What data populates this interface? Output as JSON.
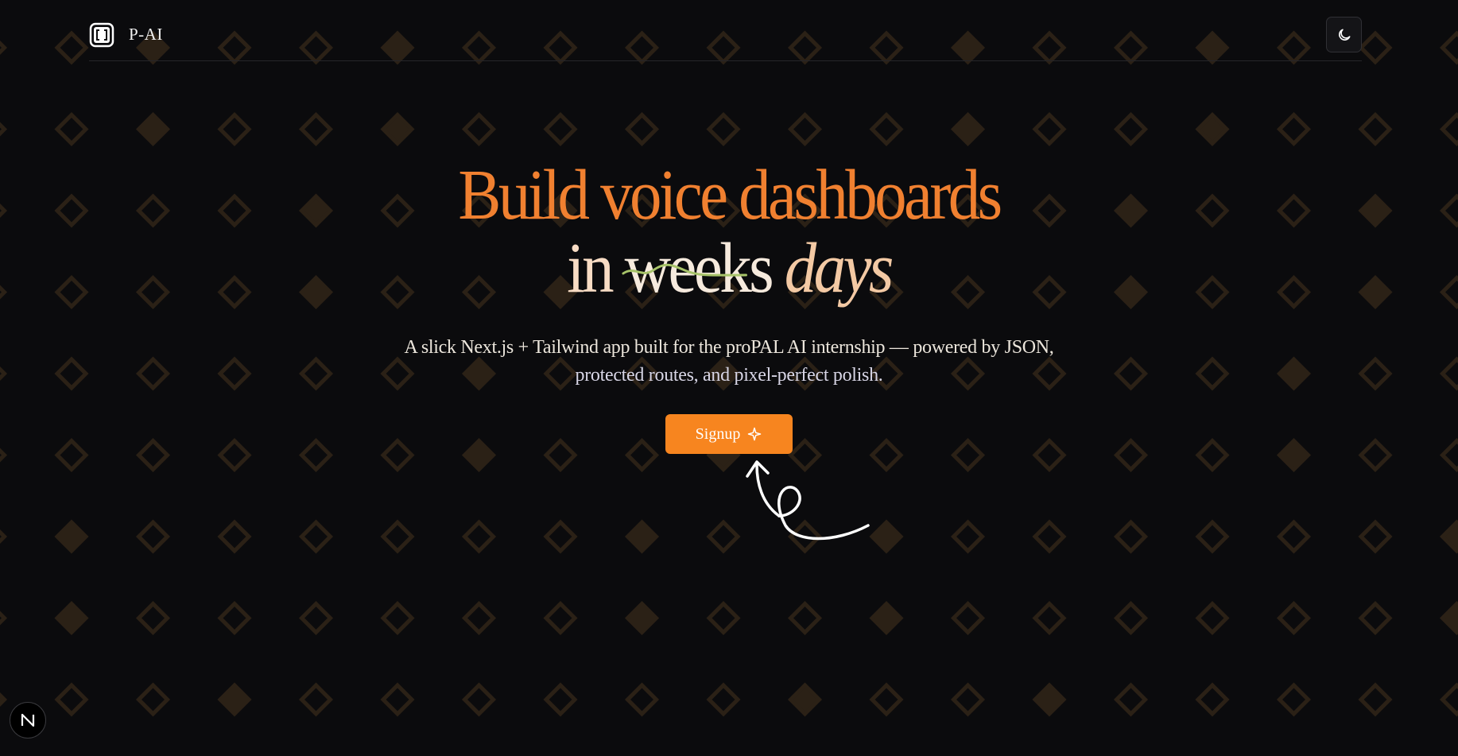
{
  "header": {
    "logo_icon": "bracket-logo-icon",
    "brand": "P-AI",
    "theme_toggle_icon": "moon-icon"
  },
  "hero": {
    "headline_line1": "Build voice dashboards",
    "headline_in": "in",
    "headline_struck": "weeks",
    "headline_days": "days",
    "subtitle_line1": "A slick Next.js + Tailwind app built for the proPAL AI internship — powered by JSON,",
    "subtitle_line2": "protected routes, and pixel-perfect polish.",
    "signup_label": "Signup",
    "signup_icon": "sparkle-icon"
  },
  "dev_badge": {
    "icon": "nextjs-icon"
  },
  "colors": {
    "accent": "#f7851f",
    "background": "#0b0b0d",
    "pattern": "#2b2116"
  }
}
